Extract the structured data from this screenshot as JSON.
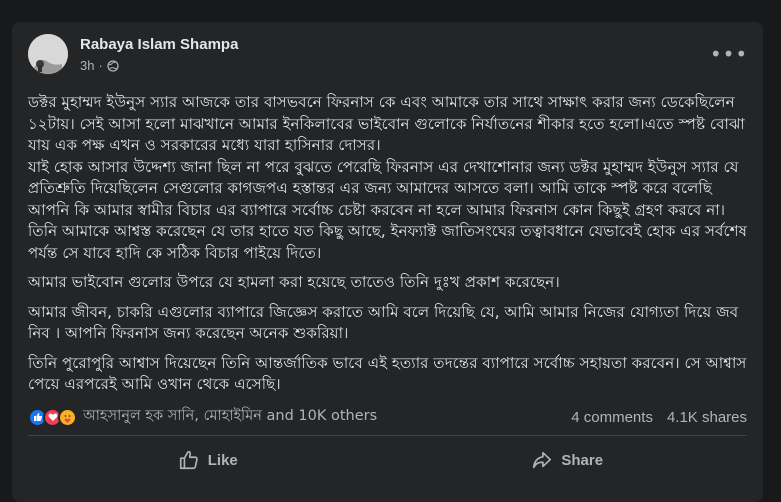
{
  "post": {
    "author": "Rabaya Islam Shampa",
    "time": "3h",
    "separator": "·",
    "privacy_icon": "globe-icon",
    "more_label": "•••",
    "paragraphs": [
      "ডক্টর মুহাম্মদ ইউনুস স্যার আজকে তার বাসভবনে ফিরনাস কে এবং আমাকে তার সাথে সাক্ষাৎ করার জন্য ডেকেছিলেন ১২টায়। সেই আসা হলো মাঝখানে আমার ইনকিলাবের ভাইবোন গুলোকে নির্যাতনের শীকার হতে হলো।এতে স্পষ্ট বোঝা যায় এক পক্ষ এখন ও সরকারের মধ্যে যারা হাসিনার দোসর।",
      "যাই হোক আসার উদ্দেশ্য জানা ছিল না পরে বুঝতে পেরেছি ফিরনাস এর দেখাশোনার জন্য ডক্টর মুহাম্মদ ইউনুস স্যার যে প্রতিশ্রুতি দিয়েছিলেন সেগুলোর কাগজপএ হস্তান্তর এর জন্য আমাদের আসতে বলা। আমি তাকে স্পষ্ট করে বলেছি আপনি কি আমার স্বামীর বিচার এর ব্যাপারে সর্বোচ্চ চেষ্টা করবেন না হলে আমার ফিরনাস কোন কিছুই গ্রহণ করবে না। তিনি আমাকে আশ্বস্ত করেছেন যে তার হাতে যত কিছু আছে, ইনফ্যাক্ট জাতিসংঘের তত্বাবধানে যেভাবেই হোক এর সর্বশেষ পর্যন্ত সে যাবে হাদি কে সঠিক বিচার পাইয়ে দিতে।",
      "আমার ভাইবোন গুলোর উপরে যে হামলা করা হয়েছে তাতেও তিনি দুঃখ প্রকাশ করেছেন।",
      "আমার জীবন, চাকরি এগুলোর ব্যাপারে জিজ্ঞেস করাতে আমি বলে দিয়েছি যে, আমি আমার নিজের যোগ্যতা দিয়ে জব নিব । আপনি ফিরনাস জন্য করেছেন অনেক শুকরিয়া।",
      "তিনি পুরোপুরি আশ্বাস দিয়েছেন তিনি আন্তর্জাতিক ভাবে এই হত্যার তদন্তের ব্যাপারে সর্বোচ্চ সহায়তা করবেন। সে আশ্বাস পেয়ে এরপরেই আমি ওখান থেকে এসেছি।"
    ],
    "reactors": "আহসানুল হক সানি, মোহাইমিন and 10K others",
    "comments": "4 comments",
    "shares": "4.1K shares",
    "reaction_icons": [
      "like-icon",
      "love-icon",
      "care-icon"
    ],
    "actions": {
      "like": "Like",
      "share": "Share"
    }
  },
  "colors": {
    "background": "#18191a",
    "card": "#242526",
    "text_primary": "#e4e6eb",
    "text_secondary": "#b0b3b8",
    "like_blue": "#1877f2",
    "love_red": "#f33e58",
    "care_yellow": "#f7b125"
  }
}
